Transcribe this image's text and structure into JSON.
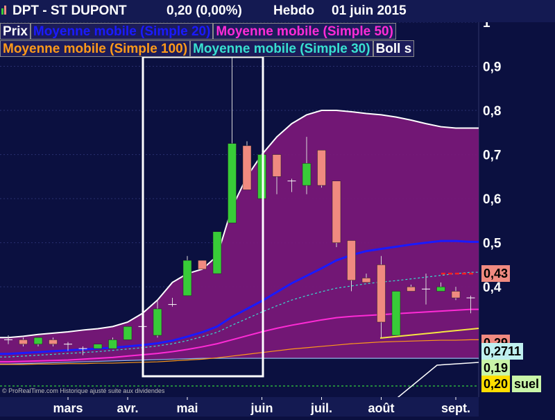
{
  "header": {
    "symbol": "DPT - ST DUPONT",
    "price_change": "0,20 (0,00%)",
    "period": "Hebdo",
    "date": "01 juin 2015",
    "icon": "bar-chart-icon"
  },
  "legend": {
    "row1": [
      {
        "label": "Prix",
        "color": "#ffffff"
      },
      {
        "label": "Moyenne mobile (Simple 20)",
        "color": "#1a1aff"
      },
      {
        "label": "Moyenne mobile (Simple 50)",
        "color": "#ff2bd6"
      }
    ],
    "row2": [
      {
        "label": "Moyenne mobile (Simple 100)",
        "color": "#ff9a1a"
      },
      {
        "label": "Moyenne mobile (Simple 30)",
        "color": "#38e0d0"
      },
      {
        "label": "Boll s",
        "color": "#ffffff"
      }
    ]
  },
  "price_labels": [
    {
      "text": "0,43",
      "value": 0.43,
      "bg": "#f08a80",
      "fg": "#000000"
    },
    {
      "text": "0,29",
      "value": 0.29,
      "bg": "#f08a80",
      "fg": "#000000"
    },
    {
      "text": "0,2711",
      "value": 0.272,
      "bg": "#bff0f0",
      "fg": "#000000"
    },
    {
      "text": "0,19",
      "value": 0.19,
      "bg": "#c9f5a8",
      "fg": "#000000"
    },
    {
      "text": "0,20",
      "value": 0.2,
      "bg": "#ffdd00",
      "fg": "#000000"
    },
    {
      "text": "suel",
      "value": 0.2,
      "bg": "#c9f5a8",
      "fg": "#000000"
    }
  ],
  "footer": "© ProRealTime.com Historique ajusté suite aux dividendes",
  "colors": {
    "background": "#0b1040",
    "bollinger_fill": "#781878",
    "up_candle": "#38cc38",
    "down_candle": "#f08a80",
    "bollinger_line": "#ffffff",
    "highlight_box": "#ffffff",
    "target_dash": "#ff2020",
    "support_dash": "#3cff3c"
  },
  "chart_data": {
    "type": "candlestick",
    "ylim": [
      0.15,
      1.0
    ],
    "y_ticks": [
      {
        "value": 1.0,
        "label": "1"
      },
      {
        "value": 0.9,
        "label": "0,9"
      },
      {
        "value": 0.8,
        "label": "0,8"
      },
      {
        "value": 0.7,
        "label": "0,7"
      },
      {
        "value": 0.6,
        "label": "0,6"
      },
      {
        "value": 0.5,
        "label": "0,5"
      },
      {
        "value": 0.4,
        "label": "0,4"
      }
    ],
    "x_ticks": [
      {
        "index": 4,
        "label": "mars"
      },
      {
        "index": 8,
        "label": "avr."
      },
      {
        "index": 12,
        "label": "mai"
      },
      {
        "index": 17,
        "label": "juin"
      },
      {
        "index": 21,
        "label": "juil."
      },
      {
        "index": 25,
        "label": "août"
      },
      {
        "index": 30,
        "label": "sept."
      }
    ],
    "candles": [
      {
        "o": 0.28,
        "h": 0.29,
        "l": 0.27,
        "c": 0.28
      },
      {
        "o": 0.28,
        "h": 0.285,
        "l": 0.265,
        "c": 0.27
      },
      {
        "o": 0.27,
        "h": 0.285,
        "l": 0.265,
        "c": 0.285
      },
      {
        "o": 0.28,
        "h": 0.285,
        "l": 0.265,
        "c": 0.27
      },
      {
        "o": 0.27,
        "h": 0.275,
        "l": 0.255,
        "c": 0.27
      },
      {
        "o": 0.26,
        "h": 0.265,
        "l": 0.245,
        "c": 0.26
      },
      {
        "o": 0.26,
        "h": 0.27,
        "l": 0.26,
        "c": 0.27
      },
      {
        "o": 0.26,
        "h": 0.285,
        "l": 0.26,
        "c": 0.28
      },
      {
        "o": 0.28,
        "h": 0.31,
        "l": 0.28,
        "c": 0.31
      },
      {
        "o": 0.31,
        "h": 0.31,
        "l": 0.3,
        "c": 0.31
      },
      {
        "o": 0.29,
        "h": 0.37,
        "l": 0.285,
        "c": 0.35
      },
      {
        "o": 0.36,
        "h": 0.375,
        "l": 0.355,
        "c": 0.36
      },
      {
        "o": 0.38,
        "h": 0.47,
        "l": 0.38,
        "c": 0.46
      },
      {
        "o": 0.46,
        "h": 0.46,
        "l": 0.44,
        "c": 0.44
      },
      {
        "o": 0.43,
        "h": 0.525,
        "l": 0.43,
        "c": 0.525
      },
      {
        "o": 0.545,
        "h": 0.93,
        "l": 0.545,
        "c": 0.725
      },
      {
        "o": 0.72,
        "h": 0.73,
        "l": 0.62,
        "c": 0.62
      },
      {
        "o": 0.6,
        "h": 0.7,
        "l": 0.6,
        "c": 0.7
      },
      {
        "o": 0.7,
        "h": 0.7,
        "l": 0.61,
        "c": 0.65
      },
      {
        "o": 0.64,
        "h": 0.645,
        "l": 0.615,
        "c": 0.64
      },
      {
        "o": 0.63,
        "h": 0.74,
        "l": 0.61,
        "c": 0.68
      },
      {
        "o": 0.71,
        "h": 0.71,
        "l": 0.625,
        "c": 0.63
      },
      {
        "o": 0.64,
        "h": 0.64,
        "l": 0.49,
        "c": 0.5
      },
      {
        "o": 0.505,
        "h": 0.505,
        "l": 0.39,
        "c": 0.415
      },
      {
        "o": 0.42,
        "h": 0.43,
        "l": 0.41,
        "c": 0.41
      },
      {
        "o": 0.45,
        "h": 0.47,
        "l": 0.285,
        "c": 0.32
      },
      {
        "o": 0.29,
        "h": 0.39,
        "l": 0.29,
        "c": 0.39
      },
      {
        "o": 0.4,
        "h": 0.405,
        "l": 0.39,
        "c": 0.39
      },
      {
        "o": 0.395,
        "h": 0.43,
        "l": 0.36,
        "c": 0.395
      },
      {
        "o": 0.39,
        "h": 0.41,
        "l": 0.39,
        "c": 0.4
      },
      {
        "o": 0.39,
        "h": 0.4,
        "l": 0.37,
        "c": 0.375
      },
      {
        "o": 0.375,
        "h": 0.38,
        "l": 0.34,
        "c": 0.375
      }
    ],
    "series": [
      {
        "name": "Moyenne mobile (Simple 20)",
        "values": [
          0.248,
          0.25,
          0.252,
          0.254,
          0.256,
          0.258,
          0.26,
          0.262,
          0.265,
          0.268,
          0.272,
          0.278,
          0.287,
          0.297,
          0.31,
          0.332,
          0.35,
          0.368,
          0.388,
          0.408,
          0.425,
          0.442,
          0.46,
          0.472,
          0.481,
          0.486,
          0.491,
          0.496,
          0.5,
          0.504,
          0.504,
          0.502
        ]
      },
      {
        "name": "Moyenne mobile (Simple 30)",
        "values": [
          0.241,
          0.243,
          0.245,
          0.247,
          0.249,
          0.251,
          0.253,
          0.256,
          0.259,
          0.262,
          0.266,
          0.271,
          0.278,
          0.287,
          0.297,
          0.313,
          0.328,
          0.343,
          0.357,
          0.37,
          0.38,
          0.389,
          0.397,
          0.402,
          0.407,
          0.411,
          0.414,
          0.418,
          0.422,
          0.426,
          0.43,
          0.433
        ]
      },
      {
        "name": "Moyenne mobile (Simple 50)",
        "values": [
          0.23,
          0.231,
          0.232,
          0.233,
          0.234,
          0.236,
          0.238,
          0.24,
          0.243,
          0.246,
          0.249,
          0.253,
          0.258,
          0.264,
          0.271,
          0.28,
          0.289,
          0.298,
          0.306,
          0.313,
          0.319,
          0.325,
          0.33,
          0.333,
          0.335,
          0.337,
          0.339,
          0.341,
          0.343,
          0.345,
          0.347,
          0.349
        ]
      },
      {
        "name": "Moyenne mobile (Simple 100)",
        "values": [
          0.224,
          0.224,
          0.225,
          0.225,
          0.226,
          0.226,
          0.227,
          0.227,
          0.228,
          0.229,
          0.23,
          0.232,
          0.234,
          0.236,
          0.239,
          0.243,
          0.247,
          0.251,
          0.255,
          0.259,
          0.262,
          0.265,
          0.268,
          0.271,
          0.273,
          0.275,
          0.276,
          0.277,
          0.278,
          0.279,
          0.279,
          0.28
        ]
      },
      {
        "name": "Boll s",
        "role": "upper",
        "values": [
          0.285,
          0.288,
          0.292,
          0.295,
          0.298,
          0.302,
          0.305,
          0.31,
          0.32,
          0.34,
          0.37,
          0.41,
          0.43,
          0.44,
          0.47,
          0.58,
          0.65,
          0.7,
          0.74,
          0.77,
          0.79,
          0.8,
          0.8,
          0.797,
          0.793,
          0.79,
          0.785,
          0.778,
          0.77,
          0.763,
          0.76,
          0.76
        ]
      },
      {
        "name": "Boll s",
        "role": "lower",
        "values": [
          0.225,
          0.226,
          0.227,
          0.228,
          0.229,
          0.23,
          0.231,
          0.232,
          0.233,
          0.234,
          0.235,
          0.236,
          0.237,
          0.238,
          0.238,
          0.238,
          0.238,
          0.238,
          0.238,
          0.238,
          0.238,
          0.238,
          0.238,
          0.238,
          0.238,
          0.238,
          0.238,
          0.238,
          0.238,
          0.238,
          0.238,
          0.238
        ]
      }
    ]
  }
}
